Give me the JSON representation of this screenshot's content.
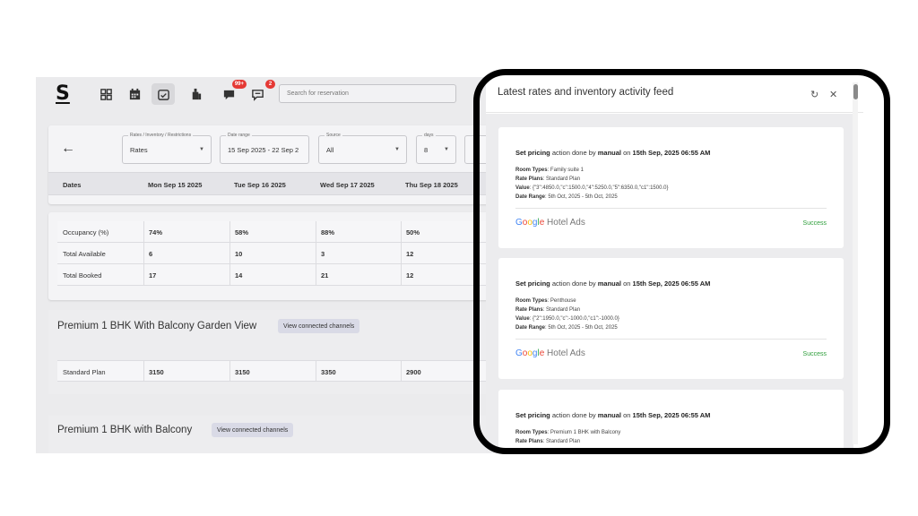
{
  "app": {
    "logo": "S",
    "nav_badges": {
      "messages": "99+",
      "chat": "2"
    },
    "search_placeholder": "Search for reservation"
  },
  "filters": {
    "view": {
      "label": "Rates / Inventory / Restrictions",
      "value": "Rates"
    },
    "date_range": {
      "label": "Date range",
      "value": "15 Sep 2025 - 22 Sep 2"
    },
    "source": {
      "label": "Source",
      "value": "All"
    },
    "days": {
      "label": "days",
      "value": "8"
    }
  },
  "grid": {
    "header": [
      "Dates",
      "Mon Sep 15 2025",
      "Tue Sep 16 2025",
      "Wed Sep 17 2025",
      "Thu Sep 18 2025"
    ],
    "stats": [
      {
        "label": "Occupancy (%)",
        "values": [
          "74%",
          "58%",
          "88%",
          "50%"
        ]
      },
      {
        "label": "Total Available",
        "values": [
          "6",
          "10",
          "3",
          "12"
        ]
      },
      {
        "label": "Total Booked",
        "values": [
          "17",
          "14",
          "21",
          "12"
        ]
      }
    ]
  },
  "rooms": [
    {
      "title": "Premium 1 BHK With Balcony Garden View",
      "chip": "View connected channels",
      "plan": "Standard Plan",
      "values": [
        "3150",
        "3150",
        "3350",
        "2900"
      ]
    },
    {
      "title": "Premium 1 BHK with Balcony",
      "chip": "View connected channels"
    }
  ],
  "feed_panel": {
    "title": "Latest rates and inventory activity feed",
    "items": [
      {
        "action": "Set pricing",
        "action_text": "action done by",
        "user": "manual",
        "on_text": "on",
        "when": "15th Sep, 2025 06:55 AM",
        "room_types_label": "Room Types",
        "room_types": "Family suite 1",
        "rate_plans_label": "Rate Plans",
        "rate_plans": "Standard Plan",
        "value_label": "Value",
        "value": "{\"3\":4850.0,\"c\":1500.0,\"4\":5250.0,\"5\":6350.0,\"c1\":1500.0}",
        "date_range_label": "Date Range",
        "date_range": "5th Oct, 2025 - 5th Oct, 2025",
        "channel": "Google Hotel Ads",
        "status": "Success"
      },
      {
        "action": "Set pricing",
        "action_text": "action done by",
        "user": "manual",
        "on_text": "on",
        "when": "15th Sep, 2025 06:55 AM",
        "room_types_label": "Room Types",
        "room_types": "Penthouse",
        "rate_plans_label": "Rate Plans",
        "rate_plans": "Standard Plan",
        "value_label": "Value",
        "value": "{\"2\":1950.0,\"c\":-1000.0,\"c1\":-1000.0}",
        "date_range_label": "Date Range",
        "date_range": "5th Oct, 2025 - 5th Oct, 2025",
        "channel": "Google Hotel Ads",
        "status": "Success"
      },
      {
        "action": "Set pricing",
        "action_text": "action done by",
        "user": "manual",
        "on_text": "on",
        "when": "15th Sep, 2025 06:55 AM",
        "room_types_label": "Room Types",
        "room_types": "Premium 1 BHK with Balcony",
        "rate_plans_label": "Rate Plans",
        "rate_plans": "Standard Plan"
      }
    ]
  },
  "colors": {
    "success": "#2e9e3b",
    "badge": "#e53935",
    "chip": "#d9dae6",
    "frame": "#000000"
  },
  "icons": [
    "dashboard-icon",
    "calendar-icon",
    "rates-icon",
    "housekeeping-icon",
    "messages-icon",
    "chat-icon",
    "back-arrow-icon",
    "refresh-icon",
    "close-icon"
  ]
}
